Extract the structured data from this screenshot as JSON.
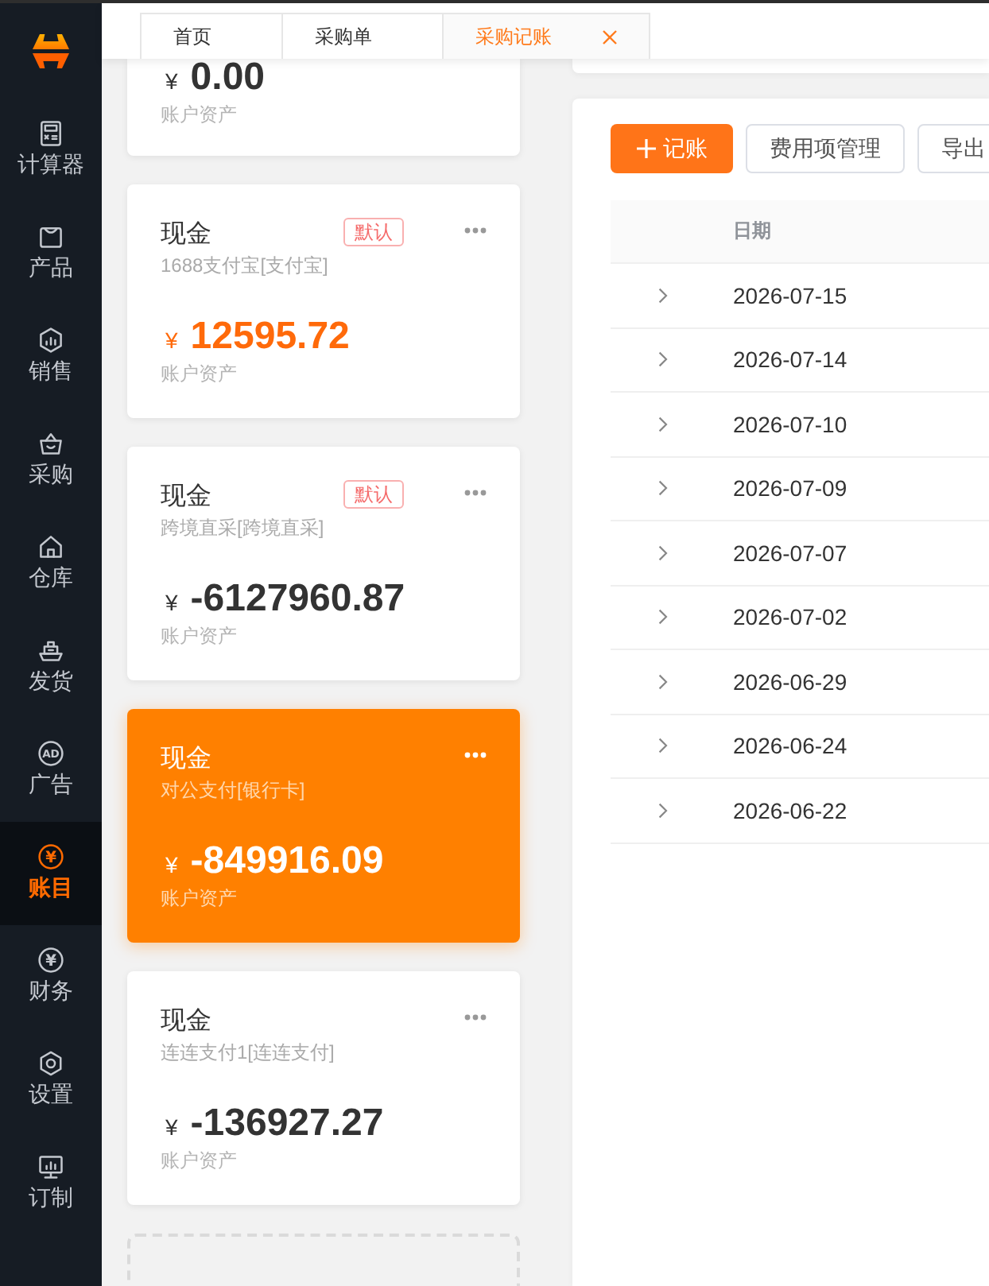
{
  "sidebar": {
    "items": [
      {
        "label": "计算器",
        "selected": false
      },
      {
        "label": "产品",
        "selected": false
      },
      {
        "label": "销售",
        "selected": false
      },
      {
        "label": "采购",
        "selected": false
      },
      {
        "label": "仓库",
        "selected": false
      },
      {
        "label": "发货",
        "selected": false
      },
      {
        "label": "广告",
        "selected": false,
        "icon_text": "AD"
      },
      {
        "label": "账目",
        "selected": true,
        "icon_text": "¥"
      },
      {
        "label": "财务",
        "selected": false,
        "icon_text": "¥"
      },
      {
        "label": "设置",
        "selected": false
      },
      {
        "label": "订制",
        "selected": false
      }
    ]
  },
  "tabs": [
    {
      "label": "首页",
      "selected": false,
      "closable": false
    },
    {
      "label": "采购单",
      "selected": false,
      "closable": false
    },
    {
      "label": "采购记账",
      "selected": true,
      "closable": true
    }
  ],
  "accounts": [
    {
      "currency": "¥",
      "amount": "0.00",
      "asset_label": "账户资产",
      "selected": false,
      "amount_highlighted": false
    },
    {
      "name": "现金",
      "badge": "默认",
      "account": "1688支付宝[支付宝]",
      "currency": "¥",
      "amount": "12595.72",
      "asset_label": "账户资产",
      "selected": false,
      "amount_highlighted": true
    },
    {
      "name": "现金",
      "badge": "默认",
      "account": "跨境直采[跨境直采]",
      "currency": "¥",
      "amount": "-6127960.87",
      "asset_label": "账户资产",
      "selected": false,
      "amount_highlighted": false
    },
    {
      "name": "现金",
      "account": "对公支付[银行卡]",
      "currency": "¥",
      "amount": "-849916.09",
      "asset_label": "账户资产",
      "selected": true,
      "amount_highlighted": false
    },
    {
      "name": "现金",
      "account": "连连支付1[连连支付]",
      "currency": "¥",
      "amount": "-136927.27",
      "asset_label": "账户资产",
      "selected": false,
      "amount_highlighted": false
    }
  ],
  "records": {
    "buttons": [
      {
        "label": "记账",
        "kind": "primary"
      },
      {
        "label": "费用项管理",
        "kind": "default"
      },
      {
        "label": "导出",
        "kind": "default"
      }
    ],
    "table": {
      "columns": [
        "日期"
      ],
      "rows": [
        {
          "date": "2026-07-15",
          "expanded": false
        },
        {
          "date": "2026-07-14",
          "expanded": false
        },
        {
          "date": "2026-07-10",
          "expanded": false
        },
        {
          "date": "2026-07-09",
          "expanded": false
        },
        {
          "date": "2026-07-07",
          "expanded": false
        },
        {
          "date": "2026-07-02",
          "expanded": false
        },
        {
          "date": "2026-06-29",
          "expanded": false
        },
        {
          "date": "2026-06-24",
          "expanded": false
        },
        {
          "date": "2026-06-22",
          "expanded": false
        }
      ]
    }
  }
}
